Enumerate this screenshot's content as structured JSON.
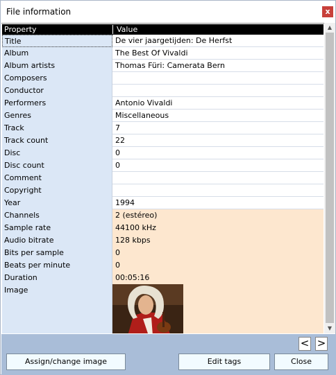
{
  "window": {
    "title": "File information",
    "close_label": "x"
  },
  "table": {
    "headers": {
      "property": "Property",
      "value": "Value"
    },
    "rows": [
      {
        "property": "Title",
        "value": "De vier jaargetijden: De Herfst"
      },
      {
        "property": "Album",
        "value": "The Best Of Vivaldi"
      },
      {
        "property": "Album artists",
        "value": "Thomas Füri: Camerata Bern"
      },
      {
        "property": "Composers",
        "value": ""
      },
      {
        "property": "Conductor",
        "value": ""
      },
      {
        "property": "Performers",
        "value": "Antonio Vivaldi"
      },
      {
        "property": "Genres",
        "value": "Miscellaneous"
      },
      {
        "property": "Track",
        "value": "7"
      },
      {
        "property": "Track count",
        "value": "22"
      },
      {
        "property": "Disc",
        "value": "0"
      },
      {
        "property": "Disc count",
        "value": "0"
      },
      {
        "property": "Comment",
        "value": ""
      },
      {
        "property": "Copyright",
        "value": ""
      },
      {
        "property": "Year",
        "value": "1994"
      },
      {
        "property": "Channels",
        "value": "2 (estéreo)"
      },
      {
        "property": "Sample rate",
        "value": "44100 kHz"
      },
      {
        "property": "Audio bitrate",
        "value": "128 kbps"
      },
      {
        "property": "Bits per sample",
        "value": "0"
      },
      {
        "property": "Beats per minute",
        "value": "0"
      },
      {
        "property": "Duration",
        "value": "00:05:16"
      },
      {
        "property": "Image",
        "value": ""
      }
    ]
  },
  "nav": {
    "prev_label": "<",
    "next_label": ">"
  },
  "buttons": {
    "assign_image": "Assign/change image",
    "edit_tags": "Edit tags",
    "close": "Close"
  }
}
